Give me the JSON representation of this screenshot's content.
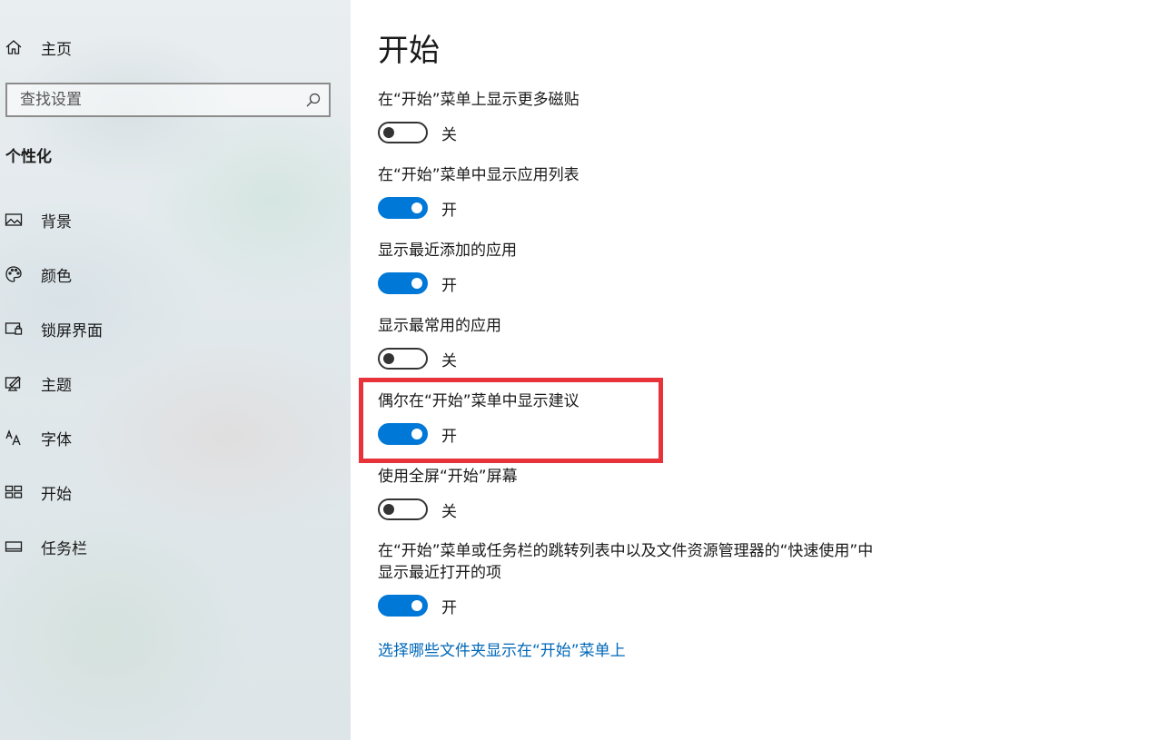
{
  "sidebar": {
    "home_label": "主页",
    "search_placeholder": "查找设置",
    "section_title": "个性化",
    "items": [
      {
        "label": "背景",
        "icon": "picture-icon"
      },
      {
        "label": "颜色",
        "icon": "palette-icon"
      },
      {
        "label": "锁屏界面",
        "icon": "lock-screen-icon"
      },
      {
        "label": "主题",
        "icon": "theme-icon"
      },
      {
        "label": "字体",
        "icon": "font-icon"
      },
      {
        "label": "开始",
        "icon": "start-icon"
      },
      {
        "label": "任务栏",
        "icon": "taskbar-icon"
      }
    ]
  },
  "main": {
    "title": "开始",
    "settings": [
      {
        "label": "在“开始”菜单上显示更多磁贴",
        "state": "关",
        "on": false
      },
      {
        "label": "在“开始”菜单中显示应用列表",
        "state": "开",
        "on": true
      },
      {
        "label": "显示最近添加的应用",
        "state": "开",
        "on": true
      },
      {
        "label": "显示最常用的应用",
        "state": "关",
        "on": false
      },
      {
        "label": "偶尔在“开始”菜单中显示建议",
        "state": "开",
        "on": true
      },
      {
        "label": "使用全屏“开始”屏幕",
        "state": "关",
        "on": false
      },
      {
        "label_line1": "在“开始”菜单或任务栏的跳转列表中以及文件资源管理器的“快速使用”中",
        "label_line2": "显示最近打开的项",
        "state": "开",
        "on": true
      }
    ],
    "link_label": "选择哪些文件夹显示在“开始”菜单上"
  },
  "colors": {
    "accent": "#0078d7",
    "link": "#0067b8",
    "highlight": "#e8333a"
  }
}
